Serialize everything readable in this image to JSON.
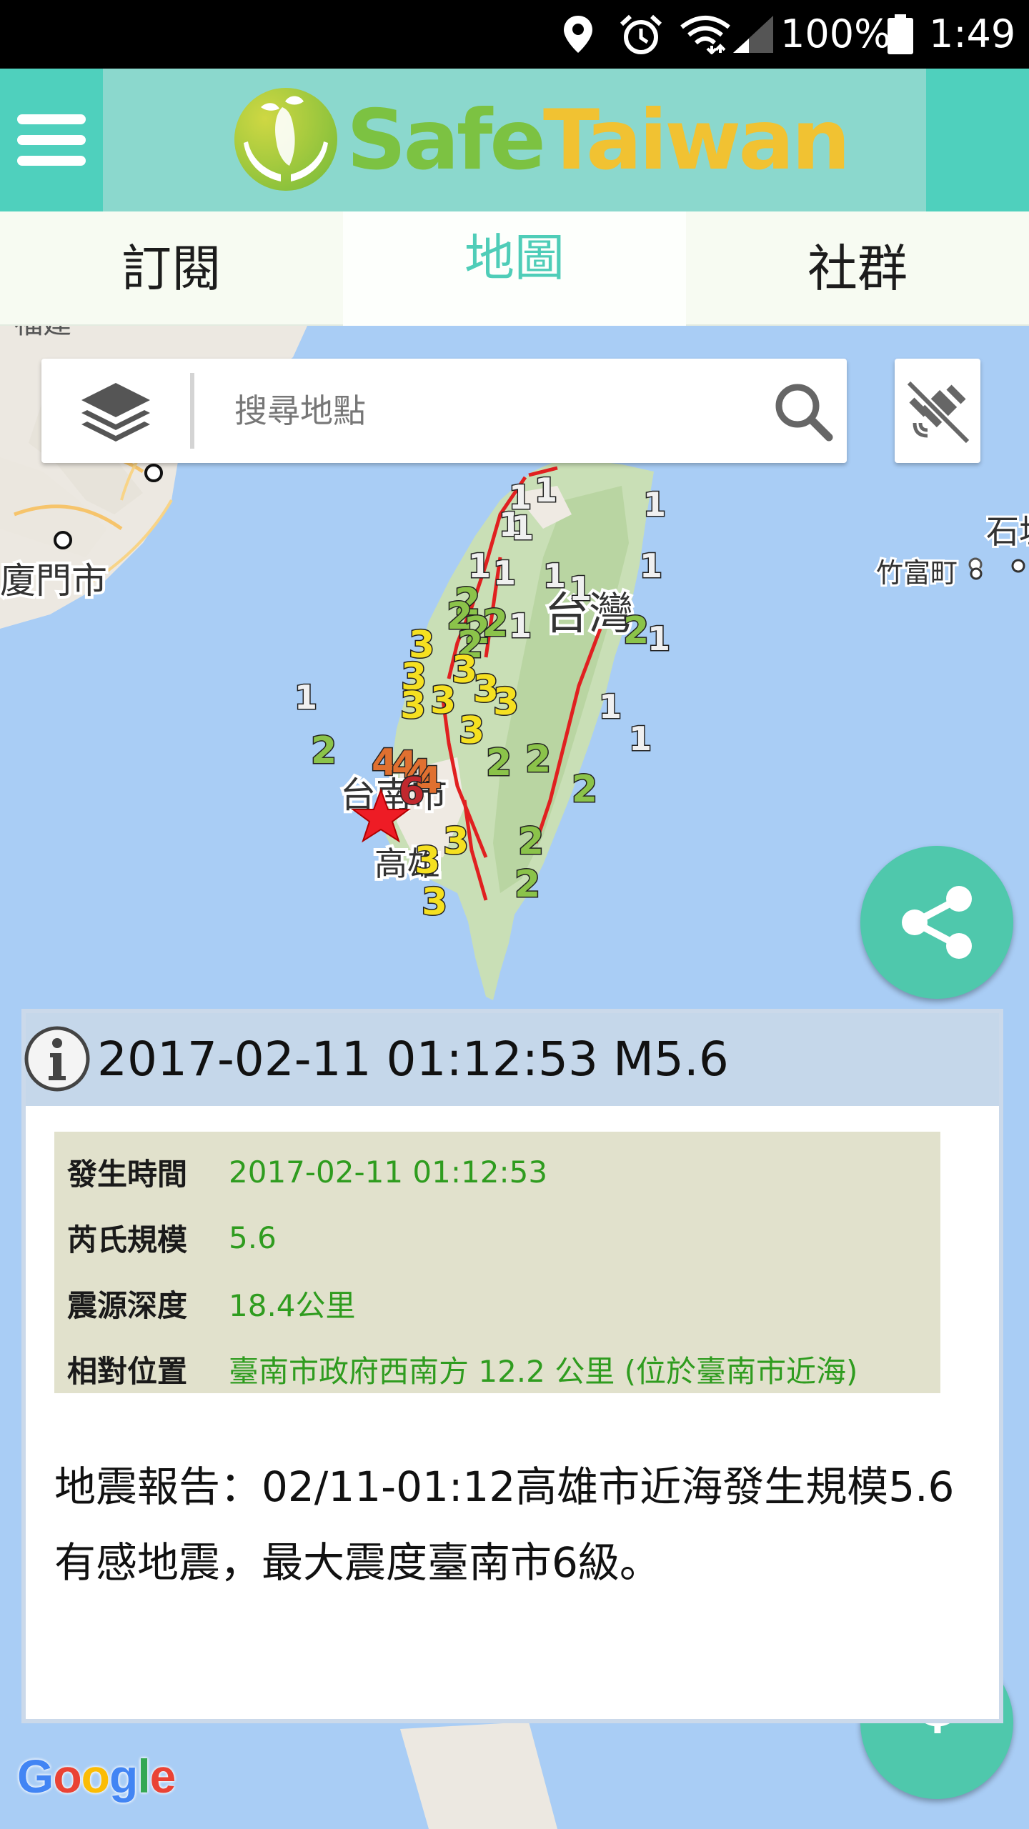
{
  "status_bar": {
    "battery": "100%",
    "time": "1:49",
    "icons": [
      "location-icon",
      "alarm-icon",
      "wifi-icon",
      "signal-icon",
      "battery-icon"
    ]
  },
  "header": {
    "logo_part1": "Safe",
    "logo_part2": "Taiwan",
    "menu_icon": "hamburger-icon",
    "colors": {
      "bar": "#4fd0bd",
      "band": "#8bd8cd",
      "logo_green": "#7cc242",
      "logo_yellow": "#f1c232"
    }
  },
  "tabs": [
    {
      "label": "訂閱",
      "active": false
    },
    {
      "label": "地圖",
      "active": true
    },
    {
      "label": "社群",
      "active": false
    }
  ],
  "map": {
    "search_placeholder": "搜尋地點",
    "place_labels": {
      "xiamen": "廈門市",
      "taiwan": "台灣",
      "tainan": "台南市",
      "kaohsiung": "高雄",
      "zhufu": "竹富町",
      "fujian": "福建",
      "shi": "石垣"
    },
    "intensity_markers": [
      "1",
      "1",
      "1",
      "1",
      "1",
      "1",
      "1",
      "1",
      "1",
      "1",
      "1",
      "1",
      "1",
      "1",
      "1",
      "2",
      "2",
      "2",
      "2",
      "2",
      "2",
      "2",
      "2",
      "2",
      "2",
      "2",
      "2",
      "3",
      "3",
      "3",
      "3",
      "3",
      "3",
      "3",
      "3",
      "3",
      "3",
      "3",
      "4",
      "4",
      "4",
      "4",
      "6"
    ],
    "attribution": "Google"
  },
  "event": {
    "title": "2017-02-11 01:12:53 M5.6",
    "details": [
      {
        "label": "發生時間",
        "value": "2017-02-11 01:12:53"
      },
      {
        "label": "芮氏規模",
        "value": "5.6"
      },
      {
        "label": "震源深度",
        "value": "18.4公里"
      },
      {
        "label": "相對位置",
        "value": "臺南市政府西南方 12.2 公里 (位於臺南市近海)"
      }
    ],
    "report": "地震報告：02/11-01:12高雄市近海發生規模5.6有感地震，最大震度臺南市6級。",
    "colors": {
      "value_green": "#2f9c1f",
      "table_bg": "#e1e1cc",
      "header_bg": "#c5d7ea"
    }
  },
  "buttons": {
    "share_icon": "share-icon",
    "locate_icon": "my-location-icon",
    "layers_icon": "layers-icon",
    "search_icon": "search-icon",
    "gps_icon": "gps-off-icon"
  }
}
